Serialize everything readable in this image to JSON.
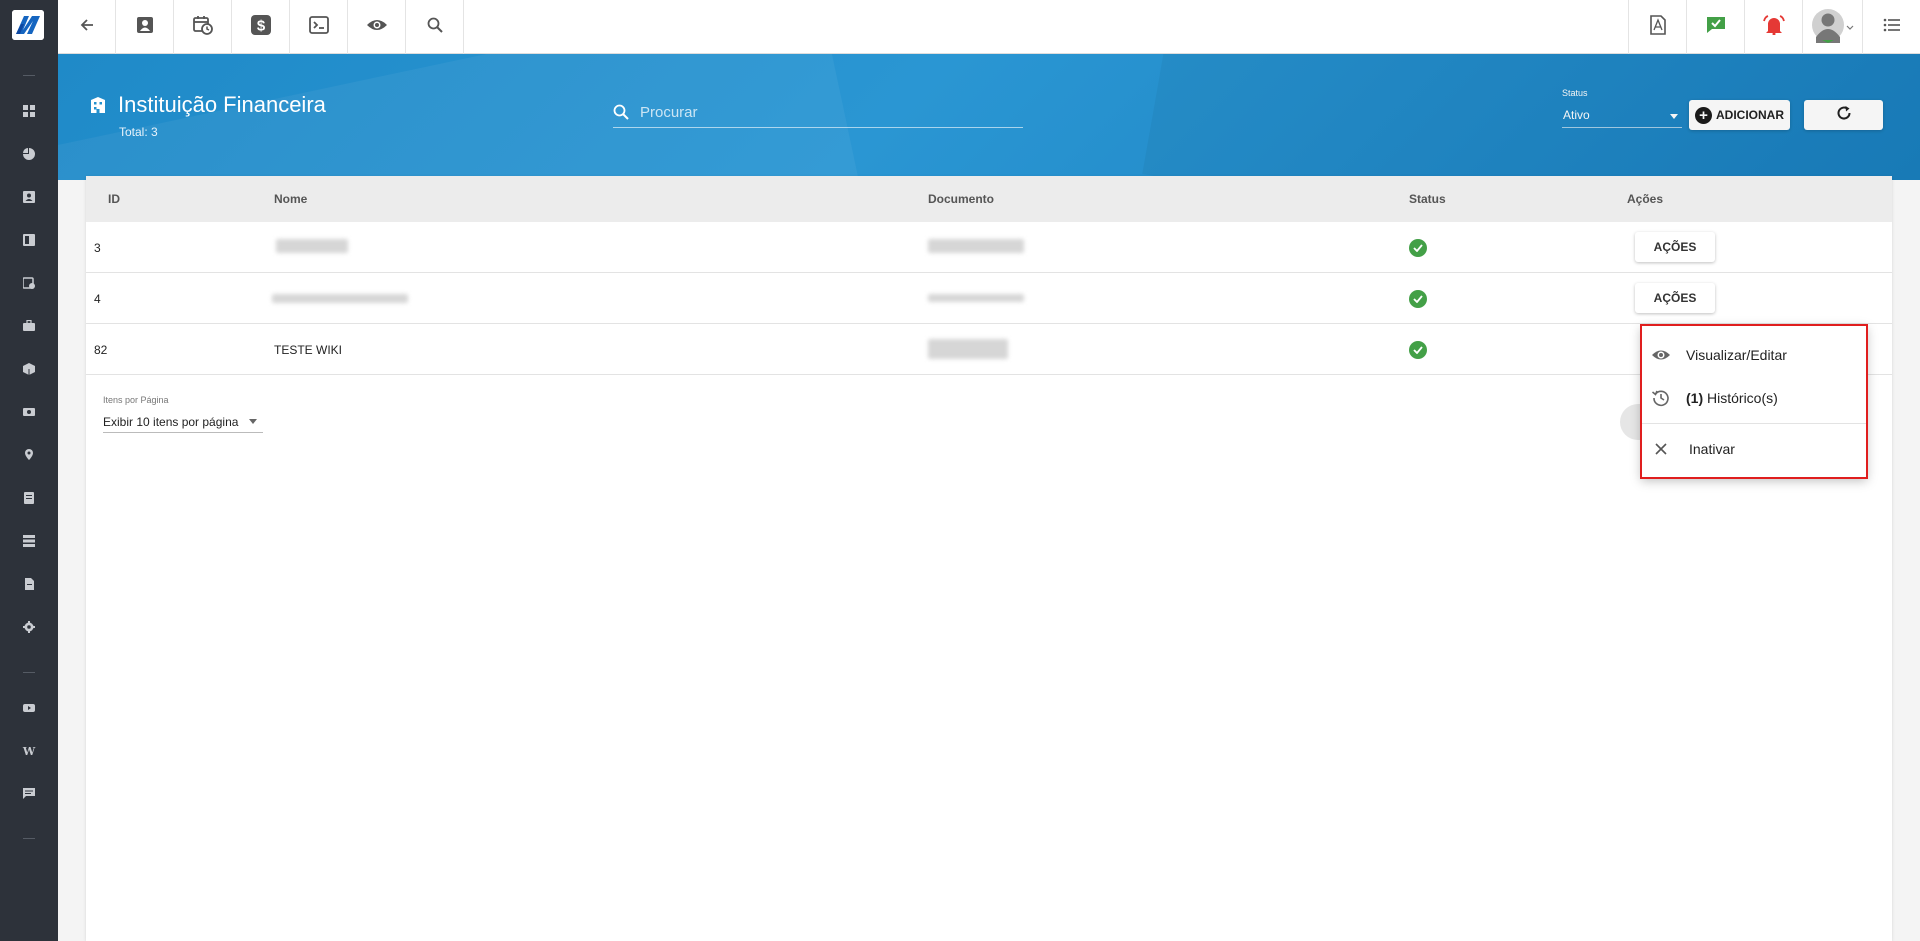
{
  "header": {
    "title": "Instituição Financeira",
    "total": "Total: 3"
  },
  "search": {
    "placeholder": "Procurar"
  },
  "status_filter": {
    "label": "Status",
    "value": "Ativo"
  },
  "buttons": {
    "add_label": "ADICIONAR"
  },
  "table": {
    "columns": [
      "ID",
      "Nome",
      "Documento",
      "Status",
      "Ações"
    ],
    "rows": [
      {
        "id": "3",
        "name": "",
        "status": "active",
        "action_label": "AÇÕES"
      },
      {
        "id": "4",
        "name": "",
        "status": "active",
        "action_label": "AÇÕES"
      },
      {
        "id": "82",
        "name": "TESTE WIKI",
        "status": "active",
        "action_label": ""
      }
    ]
  },
  "pagination": {
    "items_per_page_label": "Itens por Página",
    "items_per_page_value": "Exibir 10 itens por página"
  },
  "action_menu": {
    "items": [
      {
        "icon": "eye-icon",
        "label": "Visualizar/Editar"
      },
      {
        "icon": "history-icon",
        "count": "(1)",
        "label": " Histórico(s)"
      },
      {
        "icon": "close-icon",
        "label": "Inativar"
      }
    ]
  },
  "colors": {
    "sidebar": "#2d323a",
    "banner": "#2391ce",
    "status_ok": "#43a047",
    "highlight": "#e01e1e",
    "alert": "#e53935",
    "chat": "#43a047"
  },
  "topbar_icons": [
    "back-arrow-icon",
    "contact-card-icon",
    "calendar-clock-icon",
    "dollar-icon",
    "terminal-icon",
    "eye-icon",
    "search-icon"
  ],
  "topbar_right_icons": [
    "pdf-icon",
    "chat-check-icon",
    "alarm-icon",
    "user-avatar",
    "menu-list-icon"
  ]
}
